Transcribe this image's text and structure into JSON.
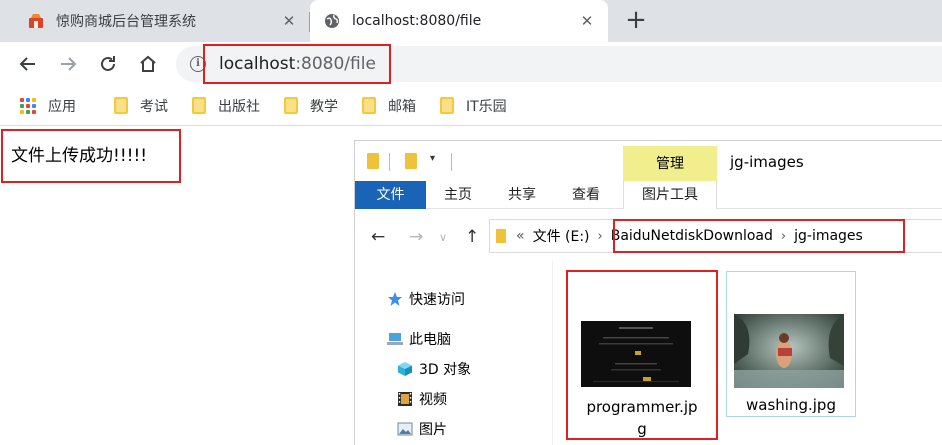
{
  "browser": {
    "tabs": [
      {
        "title": "惊购商城后台管理系统",
        "active": false
      },
      {
        "title": "localhost:8080/file",
        "active": true
      }
    ],
    "url": {
      "host": "localhost",
      "rest": ":8080/file"
    },
    "bookmarks": [
      {
        "label": "应用",
        "icon": "apps-icon"
      },
      {
        "label": "考试",
        "icon": "folder-icon"
      },
      {
        "label": "出版社",
        "icon": "folder-icon"
      },
      {
        "label": "教学",
        "icon": "folder-icon"
      },
      {
        "label": "邮箱",
        "icon": "folder-icon"
      },
      {
        "label": "IT乐园",
        "icon": "folder-icon"
      }
    ]
  },
  "page": {
    "message": "文件上传成功!!!!!"
  },
  "explorer": {
    "window_title": "jg-images",
    "context_tab": "管理",
    "ribbon_tabs": [
      "文件",
      "主页",
      "共享",
      "查看",
      "图片工具"
    ],
    "address": {
      "drive_prefix": "«",
      "crumbs": [
        "文件 (E:)",
        "BaiduNetdiskDownload",
        "jg-images"
      ]
    },
    "nav": [
      {
        "label": "快速访问",
        "icon": "star-icon"
      },
      {
        "label": "此电脑",
        "icon": "computer-icon"
      },
      {
        "label": "3D 对象",
        "icon": "cube-icon"
      },
      {
        "label": "视频",
        "icon": "film-icon"
      },
      {
        "label": "图片",
        "icon": "picture-icon"
      }
    ],
    "files": [
      {
        "line1": "programmer.jp",
        "line2": "g",
        "thumb_text": "代码没写完，哪有 脸 睡觉"
      },
      {
        "name": "washing.jpg"
      }
    ]
  },
  "colors": {
    "highlight_border": "#e02020",
    "file_tab_blue": "#1a64b8",
    "manage_yellow": "#f1ee8e"
  }
}
